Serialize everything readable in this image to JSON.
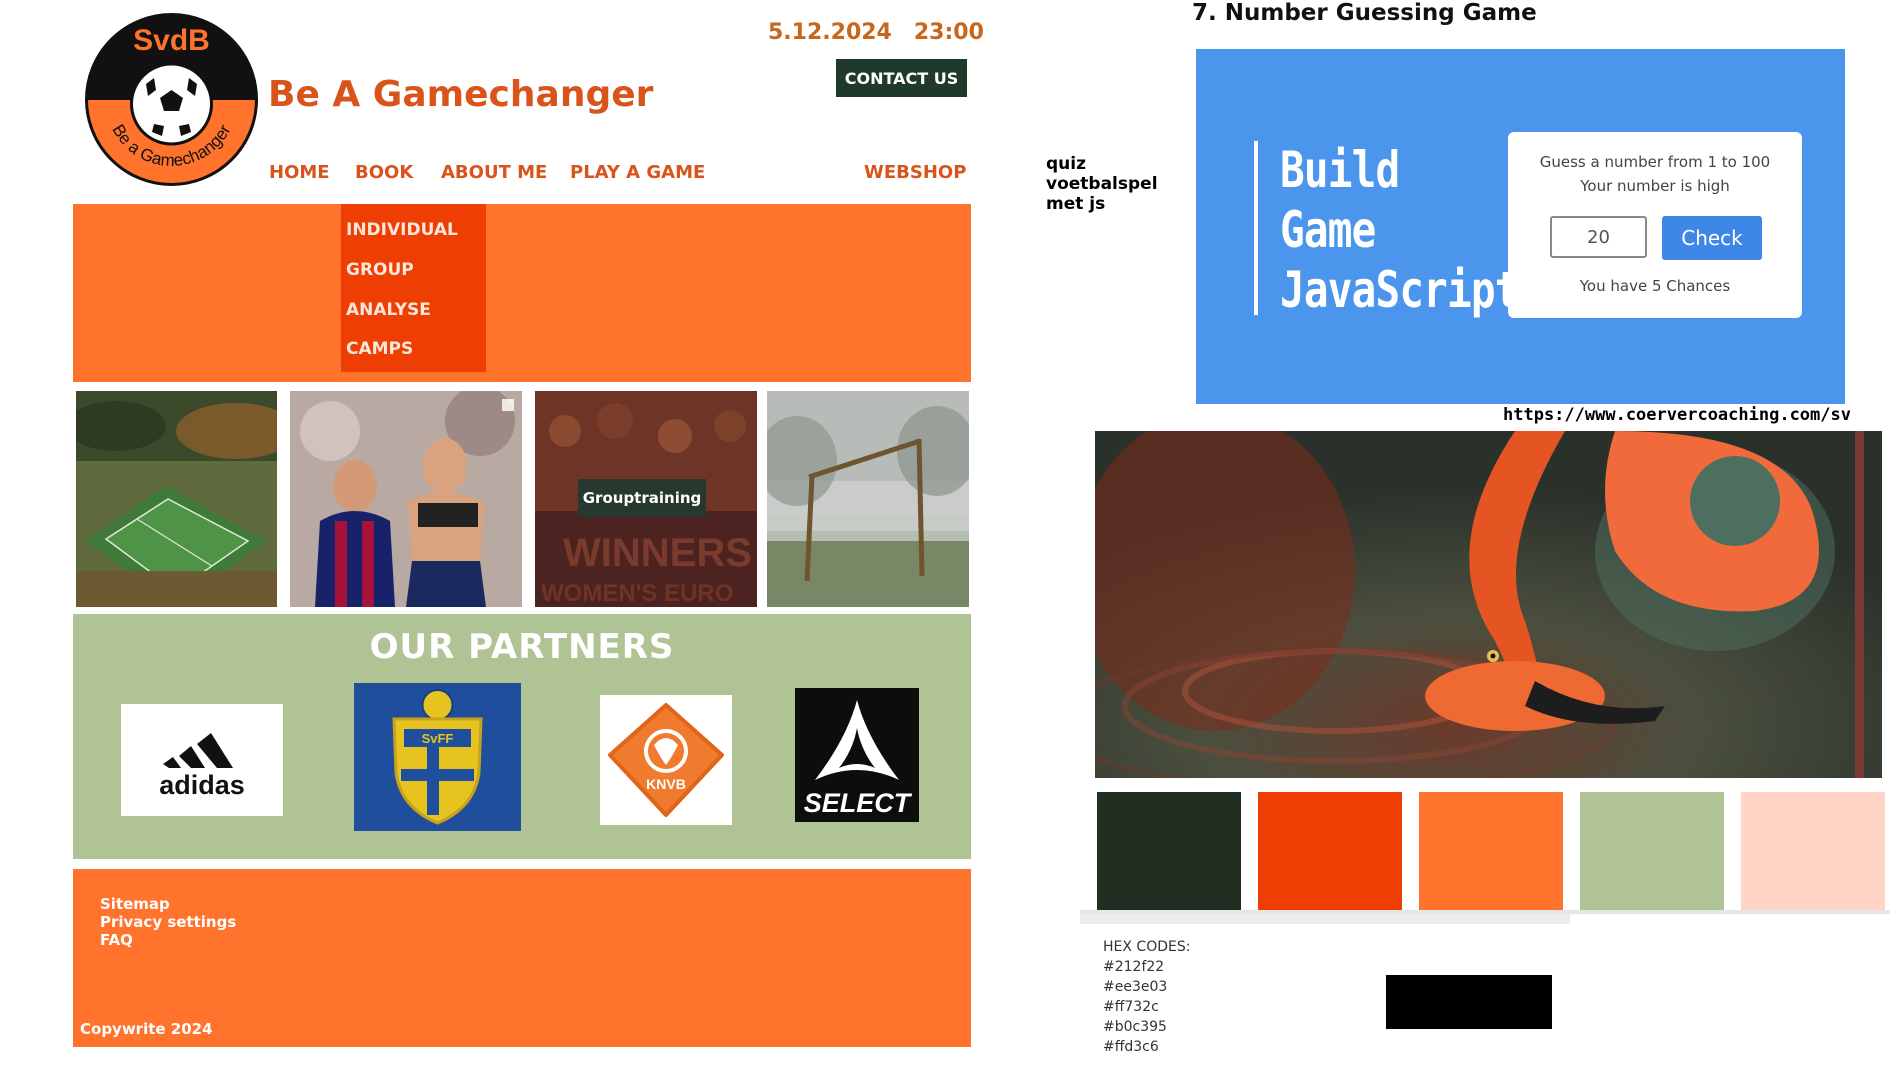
{
  "site": {
    "logo": {
      "top_text": "SvdB",
      "ring_text": "Be a Gamechanger"
    },
    "title": "Be A Gamechanger",
    "date": "5.12.2024",
    "time": "23:00",
    "contact_label": "CONTACT US",
    "nav": [
      "HOME",
      "BOOK",
      "ABOUT ME",
      "PLAY A GAME",
      "WEBSHOP"
    ],
    "dropdown": [
      "INDIVIDUAL",
      "GROUP",
      "ANALYSE",
      "CAMPS"
    ],
    "photos": {
      "overlay_label": "Grouptraining",
      "banner_text_1": "WINNERS",
      "banner_text_2": "WOMEN'S EURO"
    },
    "partners": {
      "title": "OUR PARTNERS",
      "adidas": "adidas",
      "svff": "SvFF",
      "knvb": "KNVB",
      "select": "SELECT"
    },
    "footer": {
      "links": [
        "Sitemap",
        "Privacy settings",
        "FAQ"
      ],
      "copyright": "Copywrite 2024"
    }
  },
  "notes": [
    "quiz",
    "voetbalspel",
    "met js"
  ],
  "game": {
    "heading": "7. Number Guessing Game",
    "big_words": [
      "Build",
      "Game",
      "JavaScript"
    ],
    "card_line1": "Guess a number from 1 to 100",
    "card_line2": "Your number is high",
    "input_value": "20",
    "check_label": "Check",
    "chances": "You have 5 Chances"
  },
  "reference_url": "https://www.coervercoaching.com/sv",
  "palette": {
    "heading": "HEX CODES:",
    "codes": [
      "#212f22",
      "#ee3e03",
      "#ff732c",
      "#b0c395",
      "#ffd3c6"
    ]
  }
}
